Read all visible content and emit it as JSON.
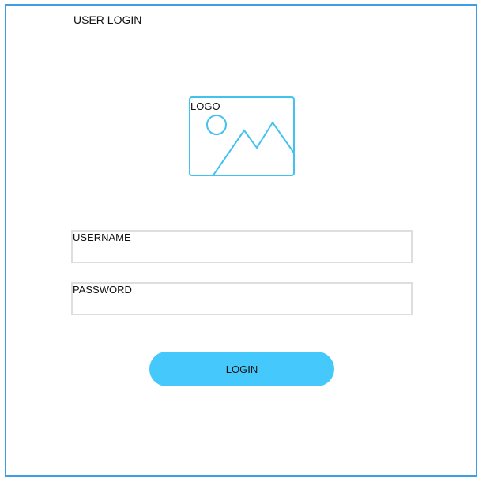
{
  "header": {
    "title": "USER LOGIN"
  },
  "logo": {
    "label": "LOGO",
    "icon": "image-placeholder-icon",
    "color": "#41c2f0"
  },
  "form": {
    "username": {
      "label": "USERNAME",
      "value": "",
      "placeholder": ""
    },
    "password": {
      "label": "PASSWORD",
      "value": "",
      "placeholder": ""
    },
    "login_label": "LOGIN"
  },
  "colors": {
    "frame_border": "#3d9ee6",
    "button": "#45c8fb",
    "field_border": "#dedede"
  }
}
